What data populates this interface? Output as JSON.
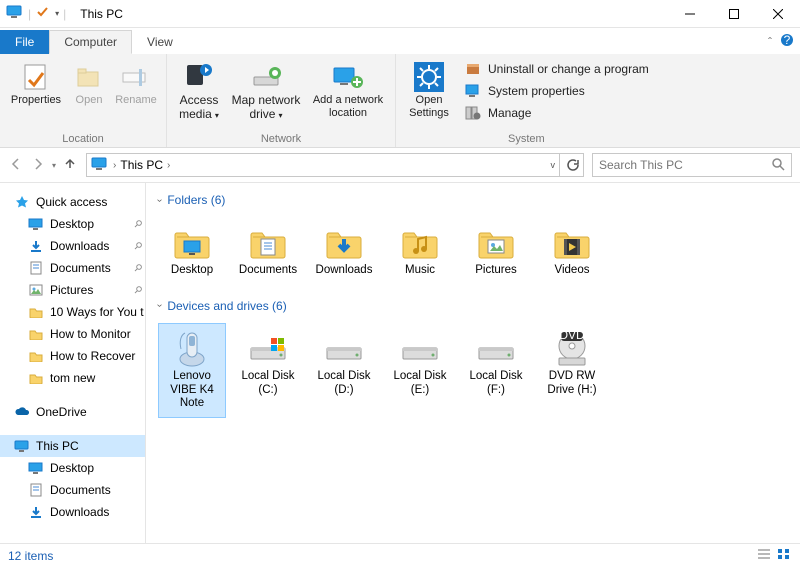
{
  "title": "This PC",
  "ribbon": {
    "tabs": {
      "file": "File",
      "computer": "Computer",
      "view": "View"
    },
    "location": {
      "group_label": "Location",
      "properties": "Properties",
      "open": "Open",
      "rename": "Rename"
    },
    "network": {
      "group_label": "Network",
      "access_media": "Access media",
      "map_drive": "Map network drive",
      "add_location": "Add a network location"
    },
    "system": {
      "group_label": "System",
      "open_settings": "Open Settings",
      "uninstall": "Uninstall or change a program",
      "properties": "System properties",
      "manage": "Manage"
    }
  },
  "address": {
    "root": "This PC"
  },
  "search": {
    "placeholder": "Search This PC"
  },
  "tree": {
    "quick_access": "Quick access",
    "qa_items": [
      {
        "label": "Desktop",
        "pinned": true
      },
      {
        "label": "Downloads",
        "pinned": true
      },
      {
        "label": "Documents",
        "pinned": true
      },
      {
        "label": "Pictures",
        "pinned": true
      },
      {
        "label": "10 Ways for You t"
      },
      {
        "label": "How to Monitor"
      },
      {
        "label": "How to Recover"
      },
      {
        "label": "tom new"
      }
    ],
    "onedrive": "OneDrive",
    "this_pc": "This PC",
    "pc_items": [
      {
        "label": "Desktop"
      },
      {
        "label": "Documents"
      },
      {
        "label": "Downloads"
      }
    ]
  },
  "main": {
    "folders_header": "Folders (6)",
    "folders": [
      {
        "label": "Desktop",
        "kind": "desktop"
      },
      {
        "label": "Documents",
        "kind": "documents"
      },
      {
        "label": "Downloads",
        "kind": "downloads"
      },
      {
        "label": "Music",
        "kind": "music"
      },
      {
        "label": "Pictures",
        "kind": "pictures"
      },
      {
        "label": "Videos",
        "kind": "videos"
      }
    ],
    "drives_header": "Devices and drives (6)",
    "drives": [
      {
        "label": "Lenovo VIBE K4 Note",
        "kind": "phone",
        "selected": true
      },
      {
        "label": "Local Disk (C:)",
        "kind": "osdisk"
      },
      {
        "label": "Local Disk (D:)",
        "kind": "disk"
      },
      {
        "label": "Local Disk (E:)",
        "kind": "disk"
      },
      {
        "label": "Local Disk (F:)",
        "kind": "disk"
      },
      {
        "label": "DVD RW Drive (H:)",
        "kind": "dvd"
      }
    ]
  },
  "status": {
    "count": "12 items"
  },
  "colors": {
    "accent": "#1979ca"
  }
}
